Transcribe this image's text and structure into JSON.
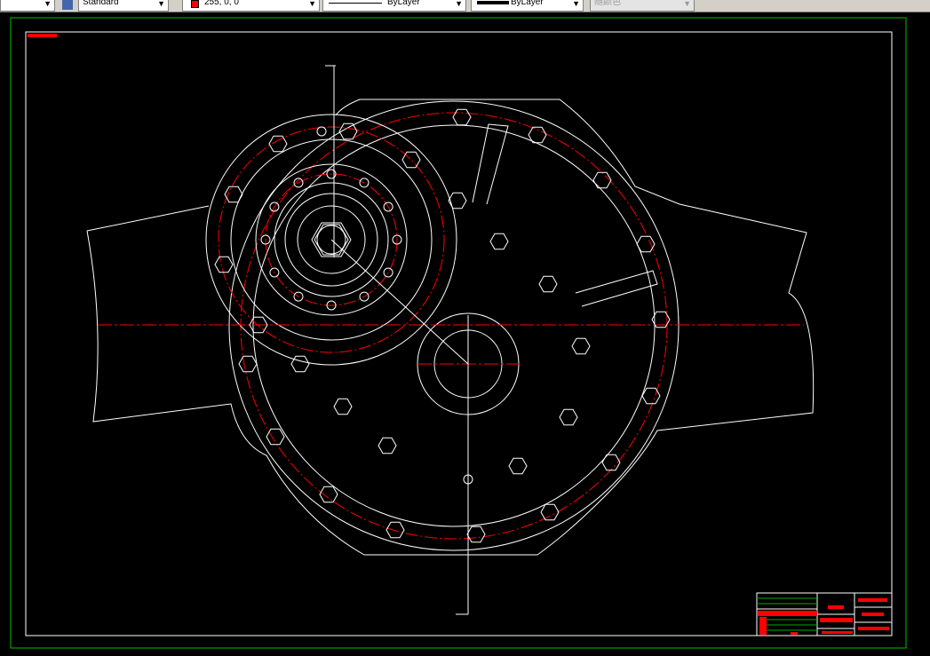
{
  "toolbar": {
    "textstyle": "Standard",
    "color": "255, 0, 0",
    "linetype": "ByLayer",
    "lineweight": "ByLayer",
    "plotstyle": "随颜色"
  },
  "colors": {
    "background": "#000000",
    "geometry": "#ffffff",
    "centerline": "#ff0000",
    "border": "#00c000",
    "selected_color": "#ff0000"
  }
}
